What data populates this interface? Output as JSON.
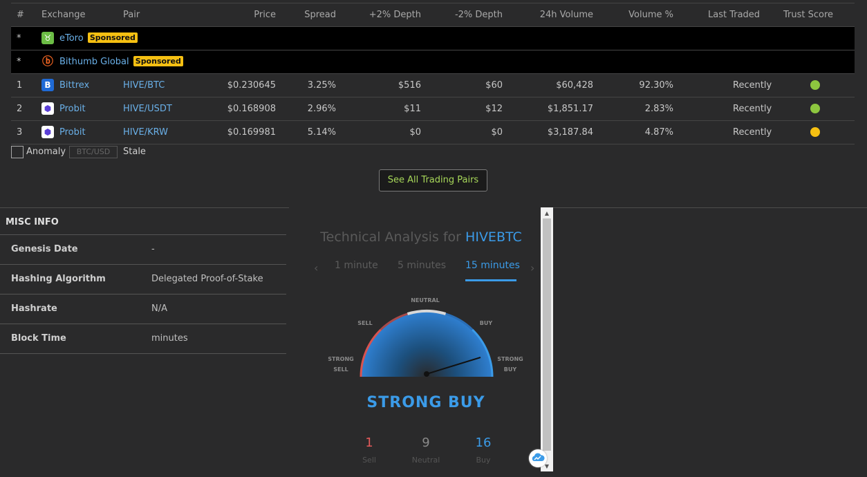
{
  "table": {
    "headers": [
      "#",
      "Exchange",
      "Pair",
      "Price",
      "Spread",
      "+2% Depth",
      "-2% Depth",
      "24h Volume",
      "Volume %",
      "Last Traded",
      "Trust Score"
    ],
    "sponsored": [
      {
        "num": "*",
        "exchange": "eToro",
        "badge": "Sponsored",
        "logo_icon": "etoro-logo-icon",
        "logo_color": "#6cbd45"
      },
      {
        "num": "*",
        "exchange": "Bithumb Global",
        "badge": "Sponsored",
        "logo_icon": "bithumb-logo-icon",
        "logo_color": "#f26522"
      }
    ],
    "rows": [
      {
        "num": "1",
        "exchange": "Bittrex",
        "pair": "HIVE/BTC",
        "price": "$0.230645",
        "spread": "3.25%",
        "depth_up": "$516",
        "depth_down": "$60",
        "volume": "$60,428",
        "volume_pct": "92.30%",
        "last": "Recently",
        "trust": "#8dc63f"
      },
      {
        "num": "2",
        "exchange": "Probit",
        "pair": "HIVE/USDT",
        "price": "$0.168908",
        "spread": "2.96%",
        "depth_up": "$11",
        "depth_down": "$12",
        "volume": "$1,851.17",
        "volume_pct": "2.83%",
        "last": "Recently",
        "trust": "#8dc63f"
      },
      {
        "num": "3",
        "exchange": "Probit",
        "pair": "HIVE/KRW",
        "price": "$0.169981",
        "spread": "5.14%",
        "depth_up": "$0",
        "depth_down": "$0",
        "volume": "$3,187.84",
        "volume_pct": "4.87%",
        "last": "Recently",
        "trust": "#f6c012"
      }
    ]
  },
  "legend": {
    "anomaly": "Anomaly",
    "btcusd": "BTC/USD",
    "stale": "Stale"
  },
  "see_all": "See All Trading Pairs",
  "misc": {
    "title": "MISC INFO",
    "rows": [
      {
        "key": "Genesis Date",
        "value": "-"
      },
      {
        "key": "Hashing Algorithm",
        "value": "Delegated Proof-of-Stake"
      },
      {
        "key": "Hashrate",
        "value": "N/A"
      },
      {
        "key": "Block Time",
        "value": "minutes"
      }
    ]
  },
  "ta": {
    "heading_prefix": "Technical Analysis for",
    "symbol": "HIVEBTC",
    "tabs": [
      "1 minute",
      "5 minutes",
      "15 minutes"
    ],
    "active_tab": "15 minutes",
    "gauge": {
      "strong_sell": [
        "STRONG",
        "SELL"
      ],
      "sell": "SELL",
      "neutral": "NEUTRAL",
      "buy": "BUY",
      "strong_buy": [
        "STRONG",
        "BUY"
      ]
    },
    "signal": "STRONG BUY",
    "counts": [
      {
        "value": "1",
        "label": "Sell",
        "color": "#e35a5a"
      },
      {
        "value": "9",
        "label": "Neutral",
        "color": "#8a8a8a"
      },
      {
        "value": "16",
        "label": "Buy",
        "color": "#3b9be8"
      }
    ]
  }
}
